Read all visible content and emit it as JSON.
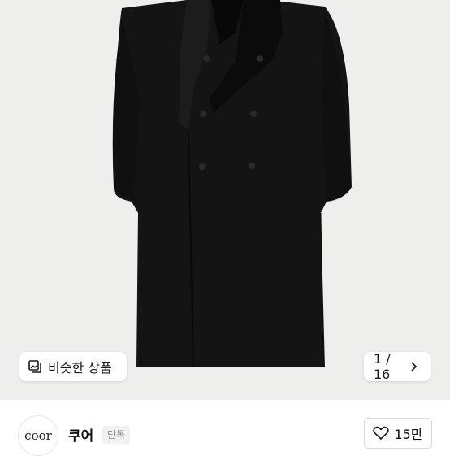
{
  "product_image": {
    "similar_products_label": "비슷한 상품",
    "image_counter": "1 / 16",
    "similar_icon": "stack-square-icon",
    "next_icon": "chevron-right-icon"
  },
  "brand": {
    "logo_text": "coor",
    "name": "쿠어",
    "badge": "단독"
  },
  "like": {
    "count": "15만",
    "icon": "heart-outline-icon"
  },
  "colors": {
    "background": "#eeeeec",
    "coat": "#141414"
  }
}
